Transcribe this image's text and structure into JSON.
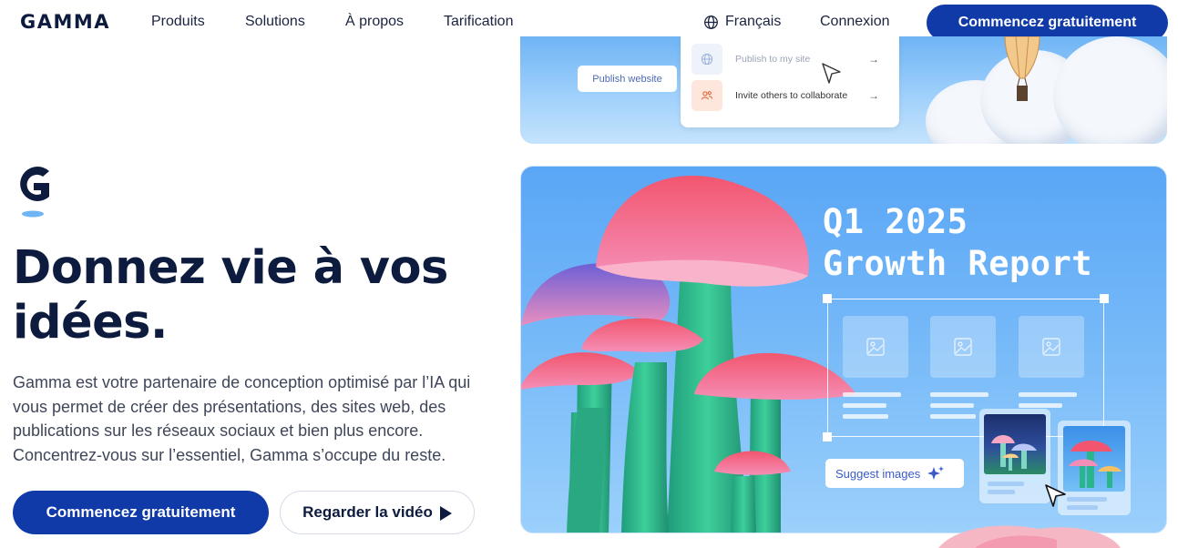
{
  "nav": {
    "logo": "GAMMA",
    "links": [
      "Produits",
      "Solutions",
      "À propos",
      "Tarification"
    ],
    "language": "Français",
    "login": "Connexion",
    "cta": "Commencez gratuitement"
  },
  "hero": {
    "title_line1": "Donnez vie à vos",
    "title_line2": "idées.",
    "description": "Gamma est votre partenaire de conception optimisé par l’IA qui vous permet de créer des présentations, des sites web, des publications sur les réseaux sociaux et bien plus encore. Concentrez-vous sur l’essentiel, Gamma s’occupe du reste.",
    "primary_cta": "Commencez gratuitement",
    "secondary_cta": "Regarder la vidéo"
  },
  "top_card": {
    "publish_button": "Publish website",
    "menu_items": [
      "Publish to my site",
      "Invite others to collaborate"
    ]
  },
  "main_card": {
    "report_line1": "Q1 2025",
    "report_line2": "Growth Report",
    "suggest_button": "Suggest images"
  },
  "colors": {
    "brand": "#0f3aa8",
    "text_dark": "#0d1b3e",
    "sky": "#74b8f8",
    "mushroom_cap": "#f05a7a",
    "mushroom_stem": "#2bb58a"
  }
}
